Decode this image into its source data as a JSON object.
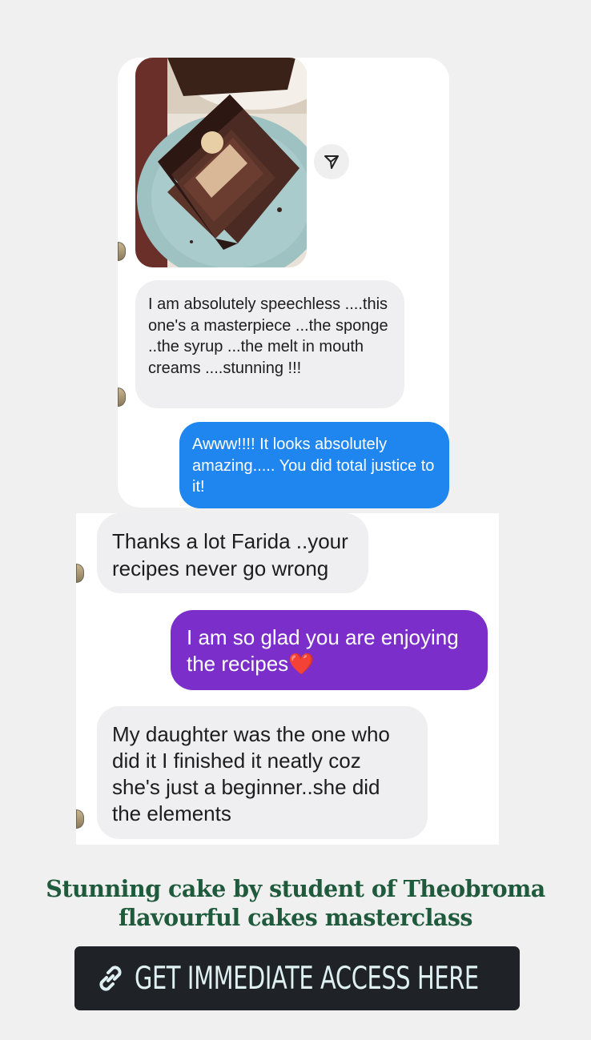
{
  "messages": [
    {
      "text": "I am absolutely speechless ....this one's  a masterpiece  ...the sponge ..the syrup ...the melt in mouth creams ....stunning !!!"
    },
    {
      "text": "Awww!!!! It looks absolutely amazing..... You did total justice to it!"
    },
    {
      "text": "Thanks a lot Farida ..your recipes never go wrong"
    },
    {
      "text": "I am so glad you are enjoying the recipes",
      "emoji": "❤️"
    },
    {
      "text": "My daughter was the one who did it I finished it neatly coz she's just a beginner..she did the elements"
    }
  ],
  "caption": {
    "line1": "Stunning cake by student of Theobroma",
    "line2": "flavourful cakes masterclass"
  },
  "cta": {
    "label": "GET IMMEDIATE ACCESS HERE",
    "icon": "link-icon"
  },
  "colors": {
    "incoming_bubble": "#efeef1",
    "outgoing_blue": "#1f86ef",
    "outgoing_purple": "#7b2ec9",
    "caption": "#1f5a3c",
    "cta_background": "#1f2226"
  }
}
